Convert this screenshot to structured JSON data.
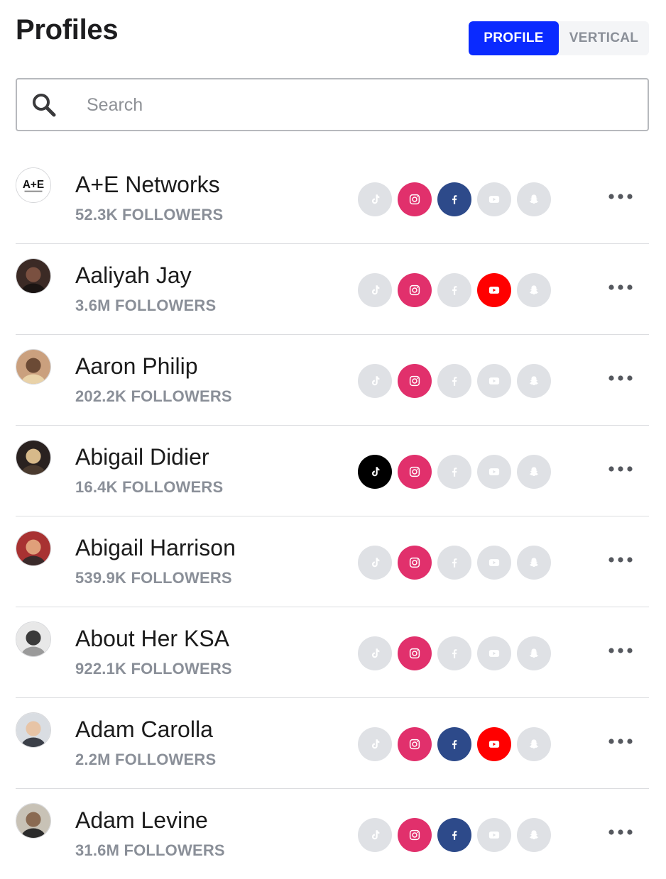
{
  "header": {
    "title": "Profiles",
    "toggle": {
      "profile_label": "PROFILE",
      "vertical_label": "VERTICAL",
      "active": "profile"
    }
  },
  "search": {
    "placeholder": "Search",
    "value": "",
    "icon": "search-icon"
  },
  "colors": {
    "accent": "#0a2aff",
    "tiktok_active": "#000000",
    "instagram_active": "#e1306c",
    "facebook_active": "#2d4a8a",
    "youtube_active": "#ff0000",
    "inactive": "#dfe1e5",
    "inactive_icon": "#ffffff",
    "muted_text": "#8a8f98"
  },
  "profiles": [
    {
      "name": "A+E Networks",
      "followers": "52.3K FOLLOWERS",
      "avatar": "logo-avatar",
      "networks": {
        "tiktok": false,
        "instagram": true,
        "facebook": true,
        "youtube": false,
        "snapchat": false
      }
    },
    {
      "name": "Aaliyah Jay",
      "followers": "3.6M FOLLOWERS",
      "avatar": "photo-avatar",
      "networks": {
        "tiktok": false,
        "instagram": true,
        "facebook": false,
        "youtube": true,
        "snapchat": false
      }
    },
    {
      "name": "Aaron Philip",
      "followers": "202.2K FOLLOWERS",
      "avatar": "photo-avatar",
      "networks": {
        "tiktok": false,
        "instagram": true,
        "facebook": false,
        "youtube": false,
        "snapchat": false
      }
    },
    {
      "name": "Abigail Didier",
      "followers": "16.4K FOLLOWERS",
      "avatar": "photo-avatar",
      "networks": {
        "tiktok": true,
        "instagram": true,
        "facebook": false,
        "youtube": false,
        "snapchat": false
      }
    },
    {
      "name": "Abigail Harrison",
      "followers": "539.9K FOLLOWERS",
      "avatar": "photo-avatar",
      "networks": {
        "tiktok": false,
        "instagram": true,
        "facebook": false,
        "youtube": false,
        "snapchat": false
      }
    },
    {
      "name": "About Her KSA",
      "followers": "922.1K FOLLOWERS",
      "avatar": "photo-avatar",
      "networks": {
        "tiktok": false,
        "instagram": true,
        "facebook": false,
        "youtube": false,
        "snapchat": false
      }
    },
    {
      "name": "Adam Carolla",
      "followers": "2.2M FOLLOWERS",
      "avatar": "photo-avatar",
      "networks": {
        "tiktok": false,
        "instagram": true,
        "facebook": true,
        "youtube": true,
        "snapchat": false
      }
    },
    {
      "name": "Adam Levine",
      "followers": "31.6M FOLLOWERS",
      "avatar": "photo-avatar",
      "networks": {
        "tiktok": false,
        "instagram": true,
        "facebook": true,
        "youtube": false,
        "snapchat": false
      }
    }
  ]
}
